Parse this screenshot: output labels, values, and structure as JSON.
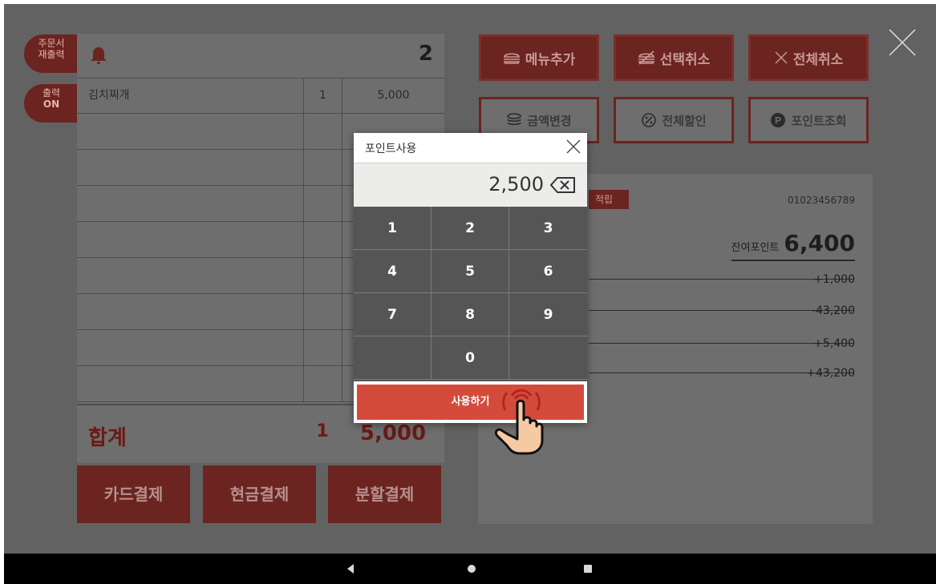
{
  "side_buttons": {
    "reprint": [
      "주문서",
      "재출력"
    ],
    "print_on": [
      "출력",
      "ON"
    ]
  },
  "order": {
    "count": "2",
    "items": [
      {
        "name": "김치찌개",
        "qty": "1",
        "price": "5,000"
      },
      {
        "name": "",
        "qty": "",
        "price": ""
      },
      {
        "name": "",
        "qty": "",
        "price": ""
      },
      {
        "name": "",
        "qty": "",
        "price": ""
      },
      {
        "name": "",
        "qty": "",
        "price": ""
      },
      {
        "name": "",
        "qty": "",
        "price": ""
      },
      {
        "name": "",
        "qty": "",
        "price": ""
      },
      {
        "name": "",
        "qty": "",
        "price": ""
      },
      {
        "name": "",
        "qty": "",
        "price": ""
      }
    ],
    "total_label": "합계",
    "total_qty": "1",
    "total_amount": "5,000"
  },
  "payment_buttons": [
    "카드결제",
    "현금결제",
    "분할결제"
  ],
  "top_buttons": {
    "add_menu": "메뉴추가",
    "cancel_selected": "선택취소",
    "cancel_all": "전체취소",
    "change_amount": "금액변경",
    "discount_all": "전체할인",
    "point_lookup": "포인트조회"
  },
  "point_panel": {
    "tag": "적립",
    "phone": "01023456789",
    "remaining_label": "잔여포인트",
    "remaining_value": "6,400",
    "history": [
      "+1,000",
      "-43,200",
      "+5,400",
      "+43,200"
    ]
  },
  "dialog": {
    "title": "포인트사용",
    "value": "2,500",
    "keys": [
      "1",
      "2",
      "3",
      "4",
      "5",
      "6",
      "7",
      "8",
      "9",
      "",
      "0",
      ""
    ],
    "use_label": "사용하기"
  },
  "colors": {
    "background": "#626262",
    "accent": "#d44b3c",
    "dark_red": "#6b2420"
  },
  "icons": [
    "bell-icon",
    "close-icon",
    "backspace-icon",
    "burger-icon",
    "coins-icon",
    "percent-icon",
    "point-p-icon",
    "tap-hand-icon",
    "nav-back-icon",
    "nav-home-icon",
    "nav-recents-icon"
  ]
}
